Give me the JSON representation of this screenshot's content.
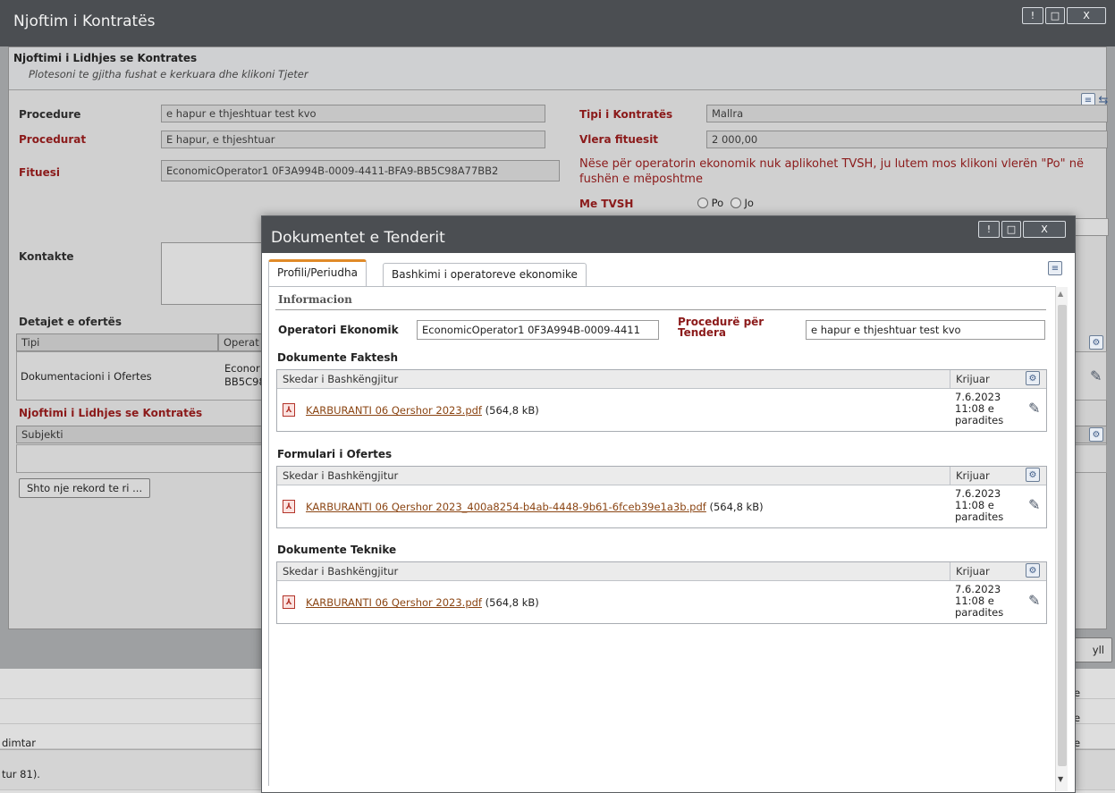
{
  "bg_window": {
    "title": "Njoftim i Kontratës",
    "controls": [
      "!",
      "□",
      "X"
    ],
    "heading": "Njoftimi i Lidhjes se Kontrates",
    "subheading": "Plotesoni te gjitha fushat e kerkuara dhe klikoni Tjeter",
    "fields": {
      "procedure_label": "Procedure",
      "procedure_value": "e hapur e thjeshtuar test kvo",
      "procedurat_label": "Procedurat",
      "procedurat_value": "E hapur, e thjeshtuar",
      "fituesi_label": "Fituesi",
      "fituesi_value": "EconomicOperator1 0F3A994B-0009-4411-BFA9-BB5C98A77BB2",
      "tipi_label": "Tipi i Kontratës",
      "tipi_value": "Mallra",
      "vlera_label": "Vlera fituesit",
      "vlera_value": "2 000,00",
      "tvsh_notice": "Nëse për operatorin ekonomik nuk aplikohet TVSH, ju lutem mos klikoni vlerën \"Po\" në fushën e mëposhtme",
      "me_tvsh_label": "Me TVSH",
      "radio_po": "Po",
      "radio_jo": "Jo",
      "kontakte_label": "Kontakte"
    },
    "detajet": {
      "title": "Detajet e ofertës",
      "col_tipi": "Tipi",
      "col_operat": "Operat",
      "row_tipi": "Dokumentacioni i Ofertes",
      "row_operat_1": "Econor",
      "row_operat_2": "BB5C98"
    },
    "njoftimi_section": {
      "title": "Njoftimi i Lidhjes se Kontratës",
      "col_subjekti": "Subjekti",
      "add_button": "Shto nje rekord te ri ..."
    },
    "right_button_partial": "yll",
    "bottom_rows": {
      "row1_right": "e",
      "row2_right": "e",
      "row3_left": "dimtar",
      "row3_right": "e",
      "status_text": "tur 81)."
    }
  },
  "modal": {
    "title": "Dokumentet e Tenderit",
    "controls": [
      "!",
      "□",
      "X"
    ],
    "tabs": [
      {
        "label": "Profili/Periudha",
        "active": true
      },
      {
        "label": "Bashkimi i operatoreve ekonomike",
        "active": false
      }
    ],
    "info_label": "Informacion",
    "operatori_label": "Operatori Ekonomik",
    "operatori_value": "EconomicOperator1 0F3A994B-0009-4411",
    "procedure_label_line1": "Procedurë për",
    "procedure_label_line2": "Tendera",
    "procedure_value": "e hapur e thjeshtuar test kvo",
    "sections": [
      {
        "title": "Dokumente Faktesh",
        "col_file": "Skedar i Bashkëngjitur",
        "col_created": "Krijuar",
        "file_name": "KARBURANTI 06 Qershor 2023.pdf",
        "file_size": "(564,8 kB)",
        "date_line1": "7.6.2023",
        "date_line2": "11:08 e",
        "date_line3": "paradites"
      },
      {
        "title": "Formulari i Ofertes",
        "col_file": "Skedar i Bashkëngjitur",
        "col_created": "Krijuar",
        "file_name": "KARBURANTI 06 Qershor 2023_400a8254-b4ab-4448-9b61-6fceb39e1a3b.pdf",
        "file_size": "(564,8 kB)",
        "date_line1": "7.6.2023",
        "date_line2": "11:08 e",
        "date_line3": "paradites"
      },
      {
        "title": "Dokumente Teknike",
        "col_file": "Skedar i Bashkëngjitur",
        "col_created": "Krijuar",
        "file_name": "KARBURANTI 06 Qershor 2023.pdf",
        "file_size": "(564,8 kB)",
        "date_line1": "7.6.2023",
        "date_line2": "11:08 e",
        "date_line3": "paradites"
      }
    ]
  },
  "colors": {
    "titlebar": "#4b4e52",
    "required_label": "#8b1a1a",
    "tab_accent": "#e08a28",
    "link": "#8b4513"
  },
  "icons": [
    "pdf-icon",
    "pencil-icon",
    "wrench-icon",
    "list-icon",
    "share-icon",
    "help-icon",
    "maximize-icon",
    "close-icon"
  ]
}
